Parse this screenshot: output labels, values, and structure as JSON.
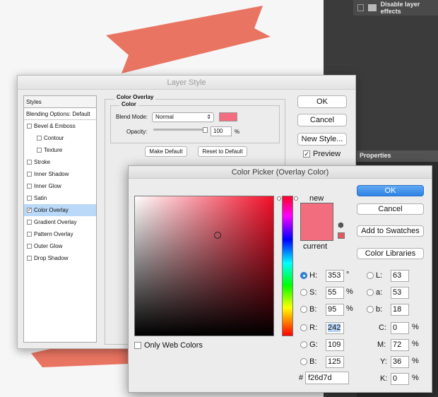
{
  "background_panel": {
    "layer_row_label": "Disable layer effects",
    "properties_tab": "Properties"
  },
  "layer_style": {
    "title": "Layer Style",
    "styles_header": "Styles",
    "blending_options": "Blending Options: Default",
    "items": [
      {
        "label": "Bevel & Emboss",
        "checked": false,
        "sub": false,
        "selected": false
      },
      {
        "label": "Contour",
        "checked": false,
        "sub": true,
        "selected": false
      },
      {
        "label": "Texture",
        "checked": false,
        "sub": true,
        "selected": false
      },
      {
        "label": "Stroke",
        "checked": false,
        "sub": false,
        "selected": false
      },
      {
        "label": "Inner Shadow",
        "checked": false,
        "sub": false,
        "selected": false
      },
      {
        "label": "Inner Glow",
        "checked": false,
        "sub": false,
        "selected": false
      },
      {
        "label": "Satin",
        "checked": false,
        "sub": false,
        "selected": false
      },
      {
        "label": "Color Overlay",
        "checked": true,
        "sub": false,
        "selected": true
      },
      {
        "label": "Gradient Overlay",
        "checked": false,
        "sub": false,
        "selected": false
      },
      {
        "label": "Pattern Overlay",
        "checked": false,
        "sub": false,
        "selected": false
      },
      {
        "label": "Outer Glow",
        "checked": false,
        "sub": false,
        "selected": false
      },
      {
        "label": "Drop Shadow",
        "checked": false,
        "sub": false,
        "selected": false
      }
    ],
    "section_title": "Color Overlay",
    "subsection_title": "Color",
    "blend_mode_label": "Blend Mode:",
    "blend_mode_value": "Normal",
    "opacity_label": "Opacity:",
    "opacity_value": "100",
    "opacity_unit": "%",
    "make_default": "Make Default",
    "reset_default": "Reset to Default",
    "ok": "OK",
    "cancel": "Cancel",
    "new_style": "New Style...",
    "preview": "Preview",
    "preview_checked": true,
    "overlay_color": "#f26d7d"
  },
  "color_picker": {
    "title": "Color Picker (Overlay Color)",
    "new_label": "new",
    "current_label": "current",
    "ok": "OK",
    "cancel": "Cancel",
    "add_to_swatches": "Add to Swatches",
    "color_libraries": "Color Libraries",
    "only_web_colors": "Only Web Colors",
    "hsb": {
      "h": "353",
      "s": "55",
      "b": "95",
      "h_unit": "°",
      "s_unit": "%",
      "b_unit": "%"
    },
    "lab": {
      "l": "63",
      "a": "53",
      "b": "18"
    },
    "rgb": {
      "r": "242",
      "g": "109",
      "b": "125"
    },
    "cmyk": {
      "c": "0",
      "m": "72",
      "y": "36",
      "k": "0",
      "unit": "%"
    },
    "hex_prefix": "#",
    "hex": "f26d7d",
    "labels": {
      "h": "H:",
      "s": "S:",
      "b": "B:",
      "l": "L:",
      "a": "a:",
      "lb": "b:",
      "r": "R:",
      "g": "G:",
      "bb": "B:",
      "c": "C:",
      "m": "M:",
      "y": "Y:",
      "k": "K:"
    }
  }
}
